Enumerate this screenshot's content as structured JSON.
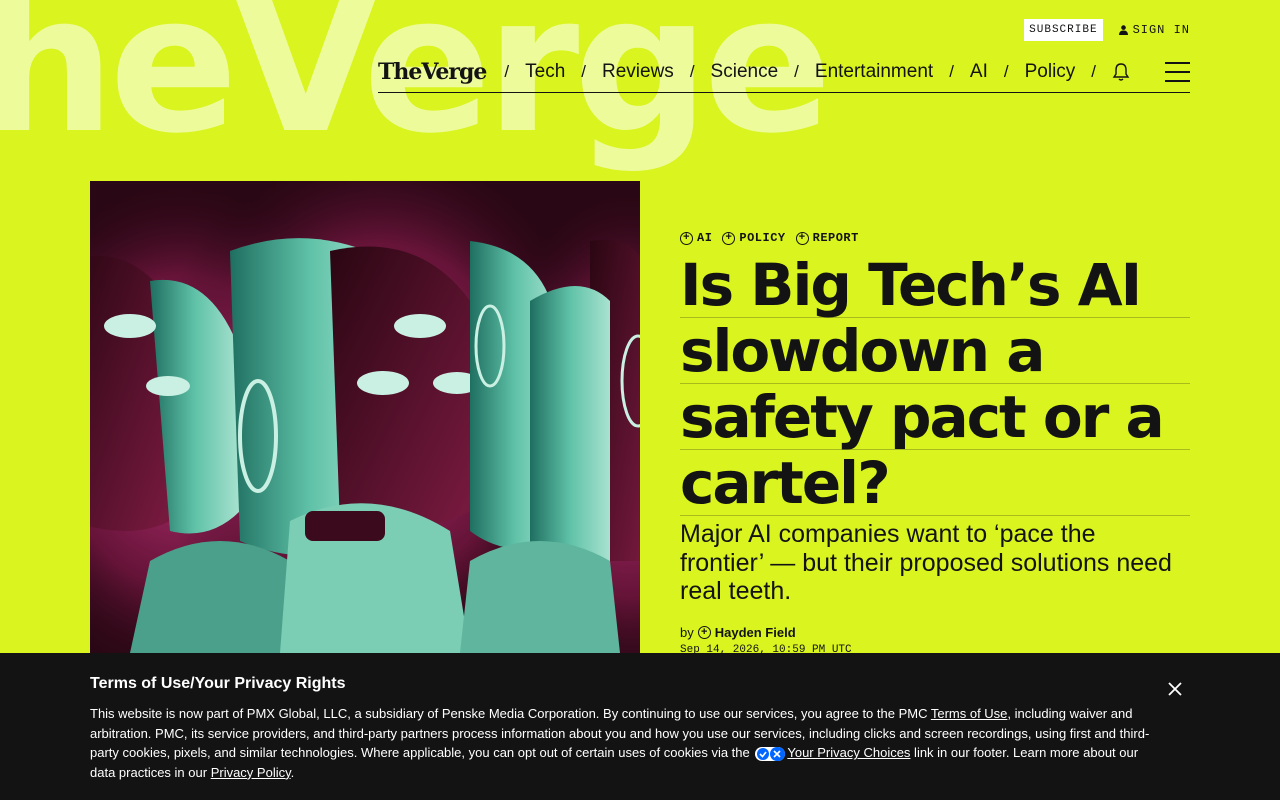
{
  "brand": {
    "background_wordmark": "heVerge",
    "logo": "TheVerge",
    "accent_color": "#d9f41f"
  },
  "topbar": {
    "subscribe_label": "SUBSCRIBE",
    "signin_label": "SIGN IN"
  },
  "nav": {
    "items": [
      {
        "label": "Tech"
      },
      {
        "label": "Reviews"
      },
      {
        "label": "Science"
      },
      {
        "label": "Entertainment"
      },
      {
        "label": "AI"
      },
      {
        "label": "Policy"
      }
    ]
  },
  "article": {
    "tags": [
      "AI",
      "POLICY",
      "REPORT"
    ],
    "headline_lines": [
      "Is Big Tech’s AI",
      "slowdown a",
      "safety pact or a",
      "cartel?"
    ],
    "dek": "Major AI companies want to ‘pace the frontier’ — but their proposed solutions need real teeth.",
    "byline_prefix": "by",
    "author": "Hayden Field",
    "date": "Sep 14, 2026, 10:59 PM UTC"
  },
  "cookie_banner": {
    "title": "Terms of Use/Your Privacy Rights",
    "text_1": "This website is now part of PMX Global, LLC, a subsidiary of Penske Media Corporation. By continuing to use our services, you agree to the PMC ",
    "terms_link": "Terms of Use",
    "text_2": ", including waiver and arbitration. PMC, its service providers, and third-party partners process information about you and how you use our services, including clicks and screen recordings, using first and third-party cookies, pixels, and similar technologies. Where applicable, you can opt out of certain uses of cookies via the ",
    "choices_link": "Your Privacy Choices",
    "text_3": " link in our footer. Learn more about our data practices in our ",
    "policy_link": "Privacy Policy",
    "text_4": "."
  }
}
